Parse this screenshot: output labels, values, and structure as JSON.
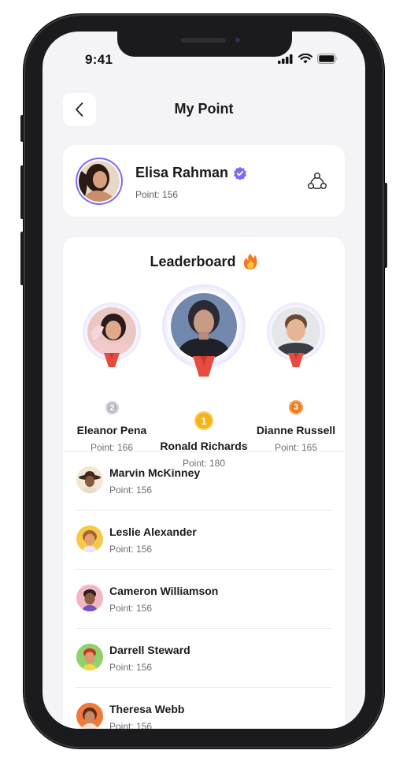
{
  "status_bar": {
    "time": "9:41"
  },
  "header": {
    "title": "My Point",
    "back_icon": "chevron-left-icon"
  },
  "profile": {
    "name": "Elisa Rahman",
    "point_text": "Point: 156",
    "verified_icon": "verified-badge-icon",
    "share_icon": "share-icon"
  },
  "leaderboard": {
    "title": "Leaderboard",
    "title_icon": "fire-icon",
    "podium": [
      {
        "rank": "2",
        "name": "Eleanor Pena",
        "point_text": "Point: 166",
        "badge_color": "#b9b9c2"
      },
      {
        "rank": "1",
        "name": "Ronald Richards",
        "point_text": "Point: 180",
        "badge_color": "#f4b31b"
      },
      {
        "rank": "3",
        "name": "Dianne Russell",
        "point_text": "Point: 165",
        "badge_color": "#f07a1a"
      }
    ],
    "list": [
      {
        "name": "Marvin McKinney",
        "point_text": "Point: 156",
        "avatar_bg": "#f3e6d2"
      },
      {
        "name": "Leslie Alexander",
        "point_text": "Point: 156",
        "avatar_bg": "#f6c94a"
      },
      {
        "name": "Cameron Williamson",
        "point_text": "Point: 156",
        "avatar_bg": "#f2b6c5"
      },
      {
        "name": "Darrell Steward",
        "point_text": "Point: 156",
        "avatar_bg": "#8fd16a"
      },
      {
        "name": "Theresa Webb",
        "point_text": "Point: 156",
        "avatar_bg": "#f07a3a"
      }
    ]
  },
  "colors": {
    "accent": "#7b6cf6",
    "ring_light": "#e4e2fd",
    "ribbon": "#e84a3d",
    "background": "#f4f4f6"
  }
}
